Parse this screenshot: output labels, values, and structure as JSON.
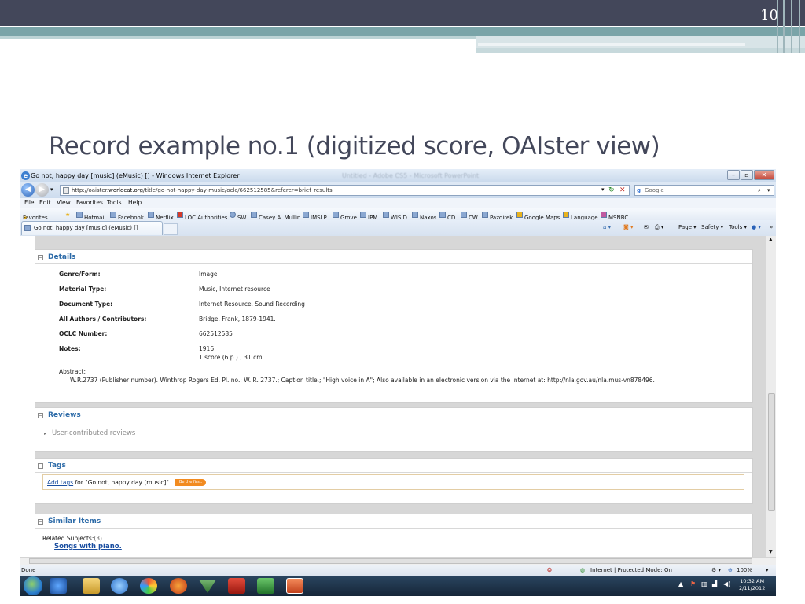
{
  "slide": {
    "number": "10",
    "title": "Record example no.1 (digitized score, OAIster view)"
  },
  "browser": {
    "window_title": "Go not, happy day [music] (eMusic) [] - Windows Internet Explorer",
    "ghost_title": "Untitled - Adobe CS5 - Microsoft PowerPoint",
    "url_prefix": "http://oaister.",
    "url_domain": "worldcat.org",
    "url_rest": "/title/go-not-happy-day-music/oclc/662512585&referer=brief_results",
    "search_placeholder": "Google",
    "menu": [
      "File",
      "Edit",
      "View",
      "Favorites",
      "Tools",
      "Help"
    ],
    "favorites_label": "Favorites",
    "favorites": [
      "Hotmail",
      "Facebook",
      "Netflix",
      "LOC Authorities",
      "SW",
      "Casey A. Mullin",
      "IMSLP",
      "Grove",
      "IPM",
      "WISID",
      "Naxos",
      "CD",
      "CW",
      "Pazdirek",
      "Google Maps",
      "Language",
      "MSNBC"
    ],
    "tab_title": "Go not, happy day [music] (eMusic) []",
    "commands": [
      "Page ▾",
      "Safety ▾",
      "Tools ▾"
    ],
    "status_done": "Done",
    "status_zone": "Internet | Protected Mode: On",
    "zoom": "100%",
    "clock_time": "10:32 AM",
    "clock_date": "2/11/2012"
  },
  "details": {
    "heading": "Details",
    "rows": [
      {
        "label": "Genre/Form:",
        "value": "Image"
      },
      {
        "label": "Material Type:",
        "value": "Music, Internet resource"
      },
      {
        "label": "Document Type:",
        "value": "Internet Resource, Sound Recording"
      },
      {
        "label": "All Authors / Contributors:",
        "value": "Bridge, Frank, 1879-1941."
      },
      {
        "label": "OCLC Number:",
        "value": "662512585"
      },
      {
        "label": "Notes:",
        "value": "1916"
      }
    ],
    "notes_line2": "1 score (6 p.) ; 31 cm.",
    "abstract_label": "Abstract:",
    "abstract_text": "W.R.2737 (Publisher number). Winthrop Rogers Ed. Pl. no.: W. R. 2737.; Caption title.; \"High voice in A\"; Also available in an electronic version via the Internet at: http://nla.gov.au/nla.mus-vn878496."
  },
  "reviews": {
    "heading": "Reviews",
    "link": "User-contributed reviews"
  },
  "tags": {
    "heading": "Tags",
    "add_link": "Add tags",
    "for_text": "for \"Go not, happy day [music]\".",
    "badge": "Be the first."
  },
  "similar": {
    "heading": "Similar Items",
    "related_label": "Related Subjects:",
    "related_count": "(3)",
    "subject_link": "Songs with piano."
  }
}
